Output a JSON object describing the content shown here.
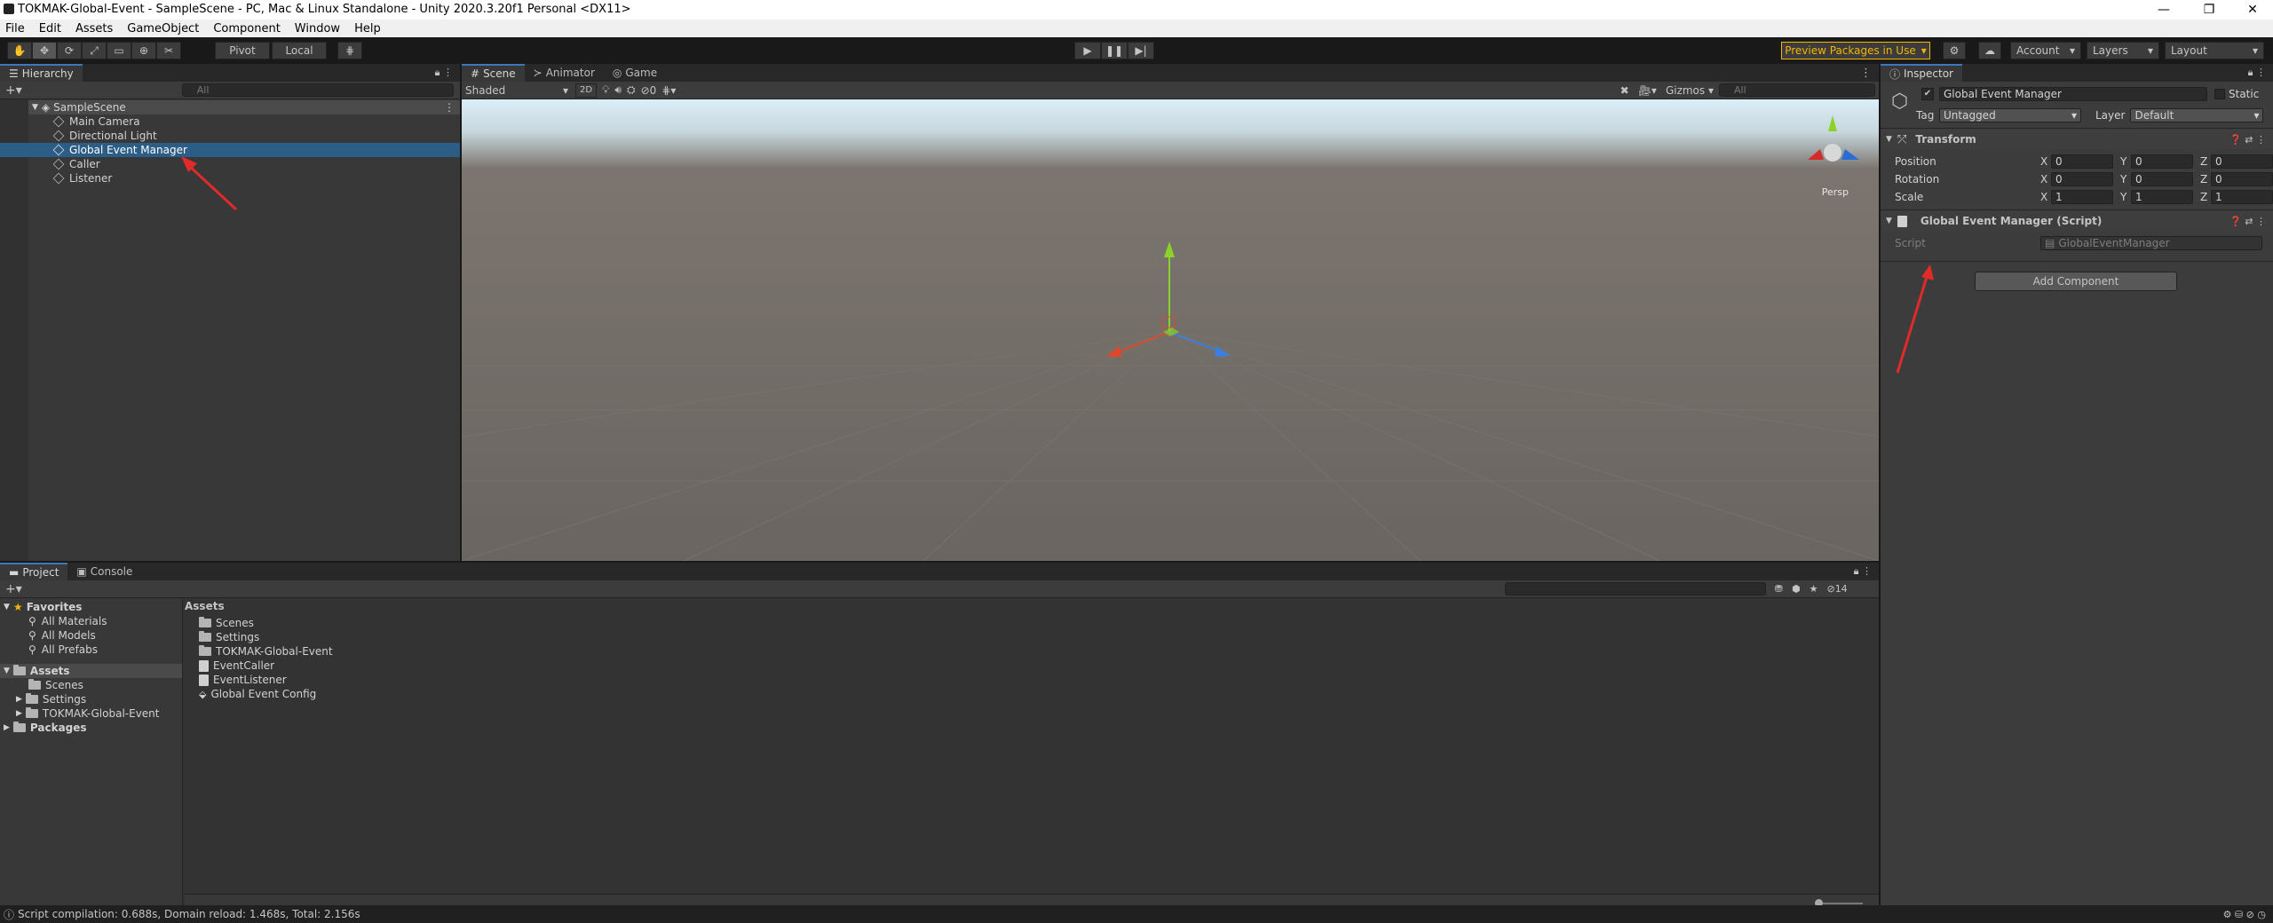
{
  "window": {
    "title": "TOKMAK-Global-Event - SampleScene - PC, Mac & Linux Standalone - Unity 2020.3.20f1 Personal <DX11>",
    "min_icon": "minimize-icon",
    "max_icon": "maximize-icon",
    "close_icon": "close-icon",
    "min_glyph": "—",
    "max_glyph": "❐",
    "close_glyph": "✕"
  },
  "menu": [
    "File",
    "Edit",
    "Assets",
    "GameObject",
    "Component",
    "Window",
    "Help"
  ],
  "toolbar": {
    "pivot": "Pivot",
    "local": "Local",
    "preview_packages": "Preview Packages in Use",
    "account": "Account",
    "layers": "Layers",
    "layout": "Layout"
  },
  "hierarchy": {
    "tab": "Hierarchy",
    "search_placeholder": "All",
    "scene": "SampleScene",
    "items": [
      "Main Camera",
      "Directional Light",
      "Global Event Manager",
      "Caller",
      "Listener"
    ],
    "selected_index": 2
  },
  "scene_view": {
    "tabs": [
      "Scene",
      "Animator",
      "Game"
    ],
    "shading": "Shaded",
    "mode_2d": "2D",
    "hidden_count": "0",
    "gizmos": "Gizmos",
    "search_placeholder": "All",
    "persp": "Persp"
  },
  "inspector": {
    "tab": "Inspector",
    "object_name": "Global Event Manager",
    "static": "Static",
    "tag_label": "Tag",
    "tag_value": "Untagged",
    "layer_label": "Layer",
    "layer_value": "Default",
    "transform": {
      "title": "Transform",
      "rows": [
        {
          "label": "Position",
          "x": "0",
          "y": "0",
          "z": "0"
        },
        {
          "label": "Rotation",
          "x": "0",
          "y": "0",
          "z": "0"
        },
        {
          "label": "Scale",
          "x": "1",
          "y": "1",
          "z": "1"
        }
      ]
    },
    "script_component": {
      "title": "Global Event Manager (Script)",
      "script_label": "Script",
      "script_value": "GlobalEventManager"
    },
    "add_component": "Add Component"
  },
  "project": {
    "tabs": [
      "Project",
      "Console"
    ],
    "hidden_count": "14",
    "favorites": {
      "title": "Favorites",
      "items": [
        "All Materials",
        "All Models",
        "All Prefabs"
      ]
    },
    "assets_tree": {
      "title": "Assets",
      "items": [
        "Scenes",
        "Settings",
        "TOKMAK-Global-Event"
      ]
    },
    "packages": "Packages",
    "breadcrumb": "Assets",
    "files": [
      {
        "name": "Scenes",
        "icon": "folder-icon"
      },
      {
        "name": "Settings",
        "icon": "folder-icon"
      },
      {
        "name": "TOKMAK-Global-Event",
        "icon": "folder-icon"
      },
      {
        "name": "EventCaller",
        "icon": "script-icon"
      },
      {
        "name": "EventListener",
        "icon": "script-icon"
      },
      {
        "name": "Global Event Config",
        "icon": "scriptable-object-icon"
      }
    ]
  },
  "status": {
    "text": "Script compilation: 0.688s, Domain reload: 1.468s, Total: 2.156s"
  },
  "colors": {
    "selection": "#2c5d87",
    "accent_blue": "#3a79bb",
    "preview_border": "#f4b400",
    "arrow_red": "#e12a2a"
  }
}
